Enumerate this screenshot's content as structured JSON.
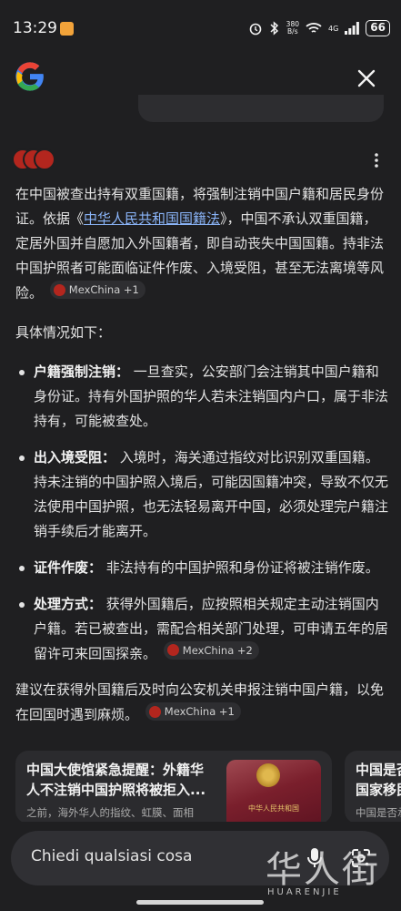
{
  "status_bar": {
    "time": "13:29",
    "net_speed_value": "380",
    "net_speed_unit": "B/s",
    "network": "4G",
    "battery": "66"
  },
  "answer": {
    "p1_before_link": "在中国被查出持有双重国籍，将强制注销中国户籍和居民身份证。依据《",
    "p1_link": "中华人民共和国国籍法",
    "p1_after_link": "》，中国不承认双重国籍，定居外国并自愿加入外国籍者，即自动丧失中国国籍。持非法中国护照者可能面临证件作废、入境受阻，甚至无法离境等风险。",
    "p1_chip": "MexChina +1",
    "intro": "具体情况如下：",
    "bullets": [
      {
        "title": "户籍强制注销：",
        "text": " 一旦查实，公安部门会注销其中国户籍和身份证。持有外国护照的华人若未注销国内户口，属于非法持有，可能被查处。",
        "chip": ""
      },
      {
        "title": "出入境受阻：",
        "text": " 入境时，海关通过指纹对比识别双重国籍。持未注销的中国护照入境后，可能因国籍冲突，导致不仅无法使用中国护照，也无法轻易离开中国，必须处理完户籍注销手续后才能离开。",
        "chip": ""
      },
      {
        "title": "证件作废：",
        "text": " 非法持有的中国护照和身份证将被注销作废。",
        "chip": ""
      },
      {
        "title": "处理方式：",
        "text": " 获得外国籍后，应按照相关规定主动注销国内户籍。若已被查出，需配合相关部门处理，可申请五年的居留许可来回国探亲。",
        "chip": "MexChina +2"
      }
    ],
    "closing": "建议在获得外国籍后及时向公安机关申报注销中国户籍，以免在回国时遇到麻烦。",
    "closing_chip": "MexChina +1"
  },
  "cards": [
    {
      "title_line1": "中国大使馆紧急提醒：外籍华",
      "title_line2": "人不注销中国护照将被拒入...",
      "snippet": "之前，海外华人的指纹、虹膜、面相",
      "thumb_text": "中华人民共和国"
    },
    {
      "title_line1": "中国是否",
      "title_line2": "国家移民",
      "snippet": "中国是否承"
    }
  ],
  "ask_bar": {
    "placeholder": "Chiedi qualsiasi cosa"
  },
  "watermark": {
    "cn": "华人街",
    "en": "HUARENJIE"
  },
  "colors": {
    "background": "#1f1f21",
    "link": "#8ab4f8",
    "chip_bg": "#2e2e31",
    "source_red": "#b3261e"
  }
}
